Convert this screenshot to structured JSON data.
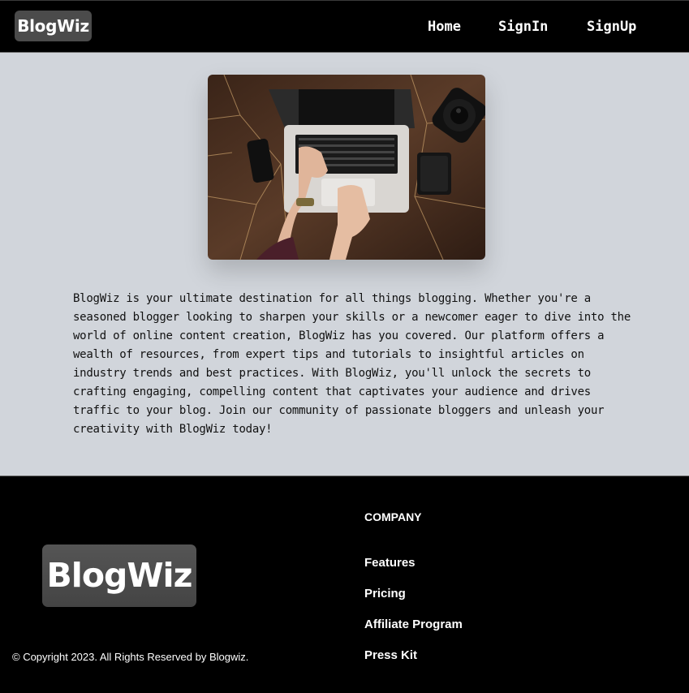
{
  "header": {
    "logo": "BlogWiz",
    "nav": [
      "Home",
      "SignIn",
      "SignUp"
    ]
  },
  "hero": {
    "image": "laptop-on-desk-photo"
  },
  "description": "BlogWiz is your ultimate destination for all things blogging. Whether you're a seasoned blogger looking to sharpen your skills or a newcomer eager to dive into the world of online content creation, BlogWiz has you covered. Our platform offers a wealth of resources, from expert tips and tutorials to insightful articles on industry trends and best practices. With BlogWiz, you'll unlock the secrets to crafting engaging, compelling content that captivates your audience and drives traffic to your blog. Join our community of passionate bloggers and unleash your creativity with BlogWiz today!",
  "footer": {
    "logo": "BlogWiz",
    "copyright": "© Copyright 2023. All Rights Reserved by Blogwiz.",
    "company_title": "COMPANY",
    "links": [
      "Features",
      "Pricing",
      "Affiliate Program",
      "Press Kit"
    ]
  },
  "colors": {
    "header_bg": "#000000",
    "page_bg": "#d1d5db",
    "logo_bg": "#4b4b4b",
    "text_light": "#ffffff"
  }
}
